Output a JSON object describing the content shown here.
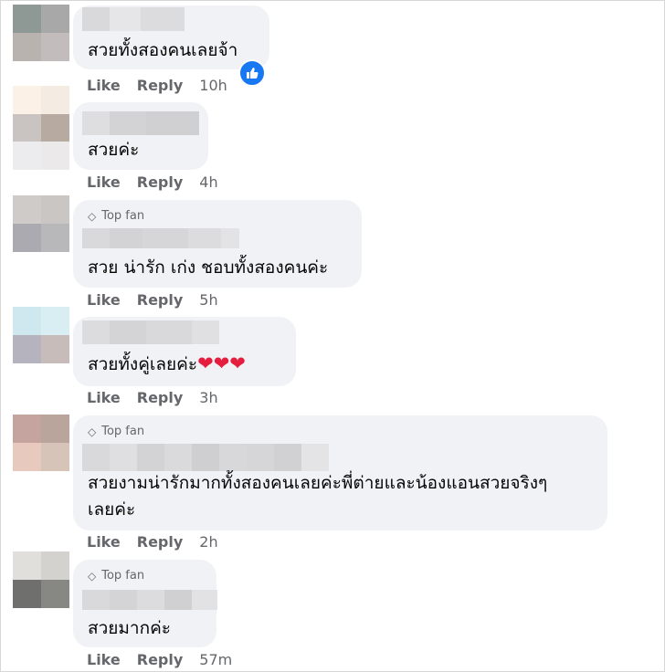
{
  "actions": {
    "like": "Like",
    "reply": "Reply"
  },
  "badge_label": "Top fan",
  "comments": [
    {
      "text": "สวยทั้งสองคนเลยจ้า",
      "time": "10h",
      "reaction_icon": "thumbs-up-icon"
    },
    {
      "text": "สวยค่ะ",
      "time": "4h"
    },
    {
      "text": "สวย น่ารัก เก่ง ชอบทั้งสองคนค่ะ",
      "time": "5h",
      "top_fan": true
    },
    {
      "text": "สวยทั้งคู่เลยค่ะ",
      "emojis": "❤❤❤",
      "time": "3h"
    },
    {
      "text_line1": "สวยงามน่ารักมากทั้งสองคนเลยค่ะพี่ต่ายและน้องแอนสวยจริงๆ",
      "text_line2": "เลยค่ะ",
      "time": "2h",
      "top_fan": true
    },
    {
      "text": "สวยมากค่ะ",
      "time": "57m",
      "top_fan": true
    }
  ],
  "colors": {
    "bubble": "#f0f2f5",
    "secondary_text": "#65676b",
    "like_blue": "#1877f2",
    "heart_red": "#e41e3f"
  }
}
